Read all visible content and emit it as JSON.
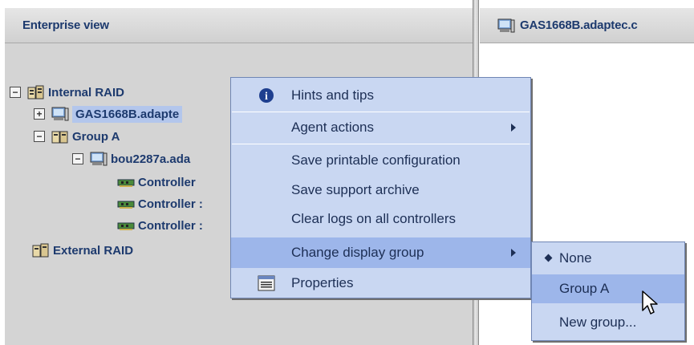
{
  "left_pane": {
    "header": "Enterprise view"
  },
  "right_pane": {
    "header": "GAS1668B.adaptec.c"
  },
  "tree": {
    "internal_raid": "Internal RAID",
    "gas": "GAS1668B.adapte",
    "group_a": "Group A",
    "bou": "bou2287a.ada",
    "controllers": [
      "Controller",
      "Controller :",
      "Controller :"
    ],
    "external_raid": "External RAID"
  },
  "context_menu": {
    "items": [
      "Hints and tips",
      "Agent actions",
      "Save printable configuration",
      "Save support archive",
      "Clear logs on all controllers",
      "Change display group",
      "Properties"
    ]
  },
  "submenu": {
    "items": [
      "None",
      "Group A",
      "New group..."
    ],
    "selected": "None"
  }
}
